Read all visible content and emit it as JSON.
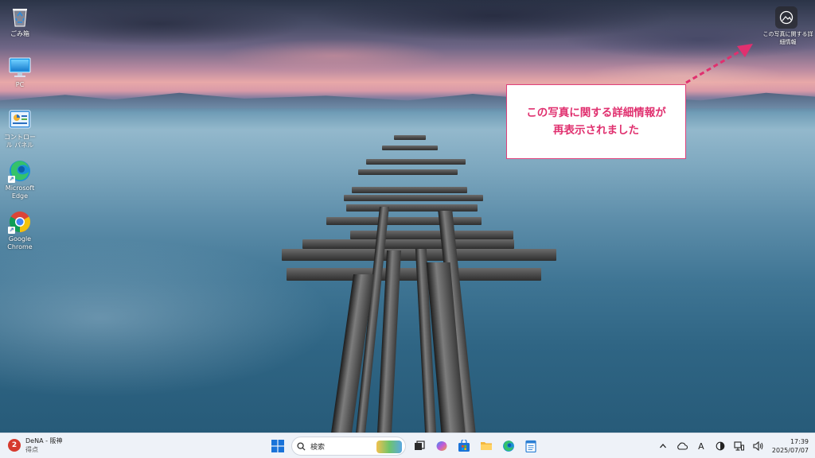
{
  "desktop": {
    "icons": [
      {
        "label": "ごみ箱",
        "icon": "recycle-bin-icon"
      },
      {
        "label": "PC",
        "icon": "monitor-icon"
      },
      {
        "label": "コントロール パネル",
        "icon": "control-panel-icon"
      },
      {
        "label": "Microsoft Edge",
        "icon": "edge-icon"
      },
      {
        "label": "Google Chrome",
        "icon": "chrome-icon"
      }
    ],
    "info_button_label": "この写真に関する詳細情報"
  },
  "callout": {
    "line1": "この写真に関する詳細情報が",
    "line2": "再表示されました",
    "color": "#e0306f"
  },
  "taskbar": {
    "news": {
      "title": "DeNA - 阪神",
      "subtitle": "得点",
      "badge": "2"
    },
    "search_placeholder": "検索",
    "apps": [
      "task-view-icon",
      "copilot-icon",
      "store-icon",
      "file-explorer-icon",
      "edge-icon",
      "notepad-icon"
    ],
    "tray": {
      "ime": "A"
    },
    "clock": {
      "time": "17:39",
      "date": "2025/07/07"
    }
  }
}
